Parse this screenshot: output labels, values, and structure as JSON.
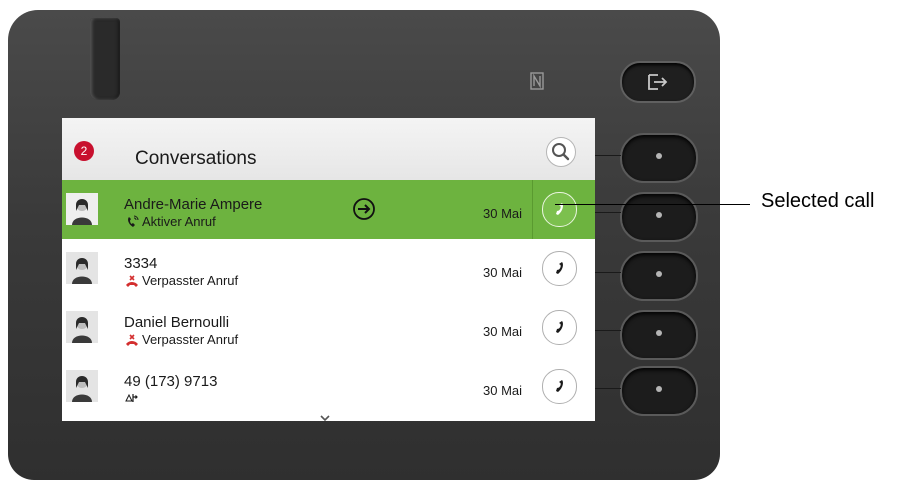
{
  "header": {
    "title": "Conversations",
    "badge_count": "2"
  },
  "conversations": [
    {
      "name": "Andre-Marie Ampere",
      "status": "Aktiver Anruf",
      "status_icon": "active-call-icon",
      "date": "30 Mai",
      "selected": true
    },
    {
      "name": "3334",
      "status": "Verpasster Anruf",
      "status_icon": "missed-call-icon",
      "date": "30 Mai",
      "selected": false
    },
    {
      "name": "Daniel Bernoulli",
      "status": "Verpasster Anruf",
      "status_icon": "missed-call-icon",
      "date": "30 Mai",
      "selected": false
    },
    {
      "name": "49 (173) 9713",
      "status": "",
      "status_icon": "forwarded-call-icon",
      "date": "30 Mai",
      "selected": false
    }
  ],
  "annotation": {
    "label": "Selected call"
  },
  "colors": {
    "selected_row": "#6db33f",
    "badge": "#c8102e",
    "missed_icon": "#d32f2f"
  }
}
